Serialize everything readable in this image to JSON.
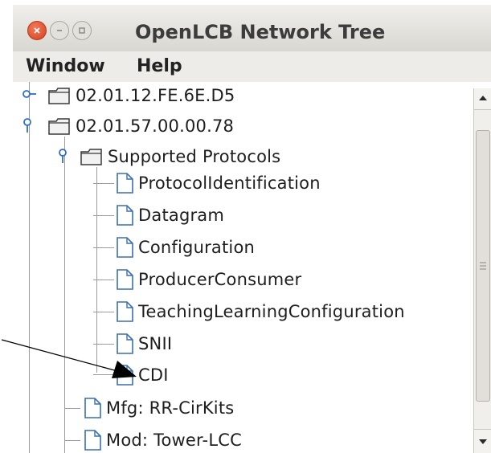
{
  "window": {
    "title": "OpenLCB Network Tree",
    "title_buttons": [
      "close-icon",
      "minimize-icon",
      "maximize-icon"
    ]
  },
  "menubar": {
    "items": [
      {
        "label": "Window"
      },
      {
        "label": "Help"
      }
    ]
  },
  "tree": {
    "nodes": [
      {
        "label": "02.01.12.FE.6E.D5",
        "kind": "folder",
        "expanded": false
      },
      {
        "label": "02.01.57.00.00.78",
        "kind": "folder",
        "expanded": true
      },
      {
        "label": "Supported Protocols",
        "kind": "folder",
        "expanded": true
      },
      {
        "label": "ProtocolIdentification",
        "kind": "leaf"
      },
      {
        "label": "Datagram",
        "kind": "leaf"
      },
      {
        "label": "Configuration",
        "kind": "leaf"
      },
      {
        "label": "ProducerConsumer",
        "kind": "leaf"
      },
      {
        "label": "TeachingLearningConfiguration",
        "kind": "leaf"
      },
      {
        "label": "SNII",
        "kind": "leaf"
      },
      {
        "label": "CDI",
        "kind": "leaf"
      },
      {
        "label": "Mfg: RR-CirKits",
        "kind": "leaf"
      },
      {
        "label": "Mod: Tower-LCC",
        "kind": "leaf"
      }
    ]
  },
  "colors": {
    "close_button": "#e0522d",
    "titlebar": "#e6e4df",
    "menubar": "#eeece8"
  },
  "annotation": {
    "type": "arrow",
    "points_to": "CDI"
  }
}
